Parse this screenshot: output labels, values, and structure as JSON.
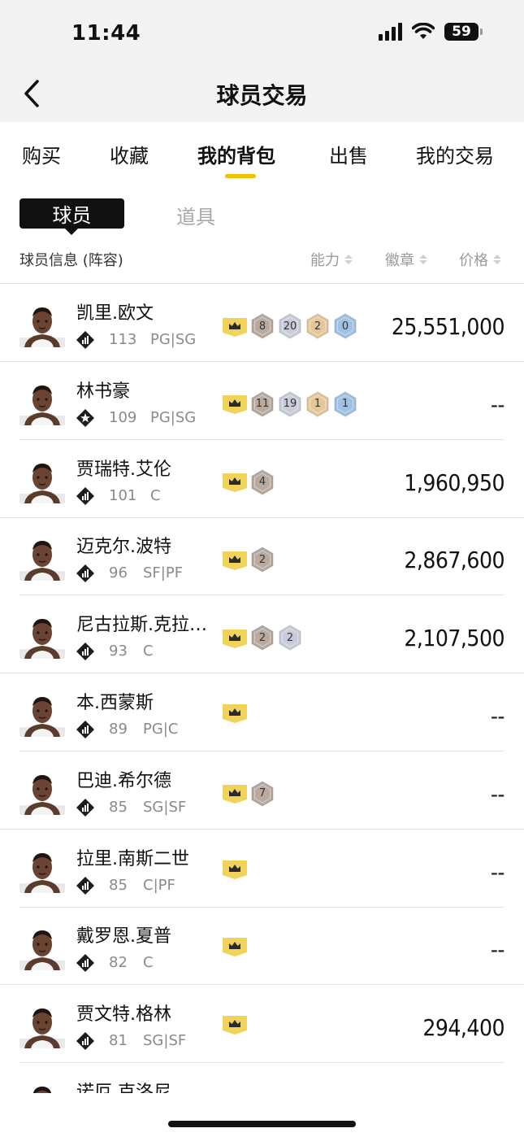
{
  "status_bar": {
    "time": "11:44",
    "battery": "59"
  },
  "header": {
    "title": "球员交易"
  },
  "tabs": [
    {
      "label": "购买"
    },
    {
      "label": "收藏"
    },
    {
      "label": "我的背包"
    },
    {
      "label": "出售"
    },
    {
      "label": "我的交易"
    }
  ],
  "segments": {
    "active": "球员",
    "inactive": "道具"
  },
  "columns": {
    "info": "球员信息 (阵容)",
    "ability": "能力",
    "badge": "徽章",
    "price": "价格"
  },
  "colors": {
    "accent": "#f2c200",
    "crown": "#f1d35a",
    "bronze": "#b9aaa0",
    "silver": "#c7ccd9",
    "gold": "#e3c79a",
    "hof": "#9fc2e3"
  },
  "players": [
    {
      "name": "凯里.欧文",
      "rating": "113",
      "position": "PG|SG",
      "tier": "diamond-icon",
      "badges": [
        "8",
        "20",
        "2",
        "0"
      ],
      "price": "25,551,000"
    },
    {
      "name": "林书豪",
      "rating": "109",
      "position": "PG|SG",
      "tier": "star-icon",
      "badges": [
        "11",
        "19",
        "1",
        "1"
      ],
      "price": "--"
    },
    {
      "name": "贾瑞特.艾伦",
      "rating": "101",
      "position": "C",
      "tier": "diamond-icon",
      "badges": [
        "4"
      ],
      "price": "1,960,950"
    },
    {
      "name": "迈克尔.波特",
      "rating": "96",
      "position": "SF|PF",
      "tier": "diamond-icon",
      "badges": [
        "2"
      ],
      "price": "2,867,600"
    },
    {
      "name": "尼古拉斯.克拉…",
      "rating": "93",
      "position": "C",
      "tier": "diamond-icon",
      "badges": [
        "2",
        "2"
      ],
      "price": "2,107,500"
    },
    {
      "name": "本.西蒙斯",
      "rating": "89",
      "position": "PG|C",
      "tier": "diamond-icon",
      "badges": [],
      "price": "--"
    },
    {
      "name": "巴迪.希尔德",
      "rating": "85",
      "position": "SG|SF",
      "tier": "diamond-icon",
      "badges": [
        "7"
      ],
      "price": "--"
    },
    {
      "name": "拉里.南斯二世",
      "rating": "85",
      "position": "C|PF",
      "tier": "diamond-icon",
      "badges": [],
      "price": "--"
    },
    {
      "name": "戴罗恩.夏普",
      "rating": "82",
      "position": "C",
      "tier": "diamond-icon",
      "badges": [],
      "price": "--"
    },
    {
      "name": "贾文特.格林",
      "rating": "81",
      "position": "SG|SF",
      "tier": "diamond-icon",
      "badges": [],
      "price": "294,400"
    },
    {
      "name": "诺厄.克洛尼",
      "rating": "",
      "position": "",
      "tier": "diamond-icon",
      "badges": [],
      "price": ""
    }
  ]
}
